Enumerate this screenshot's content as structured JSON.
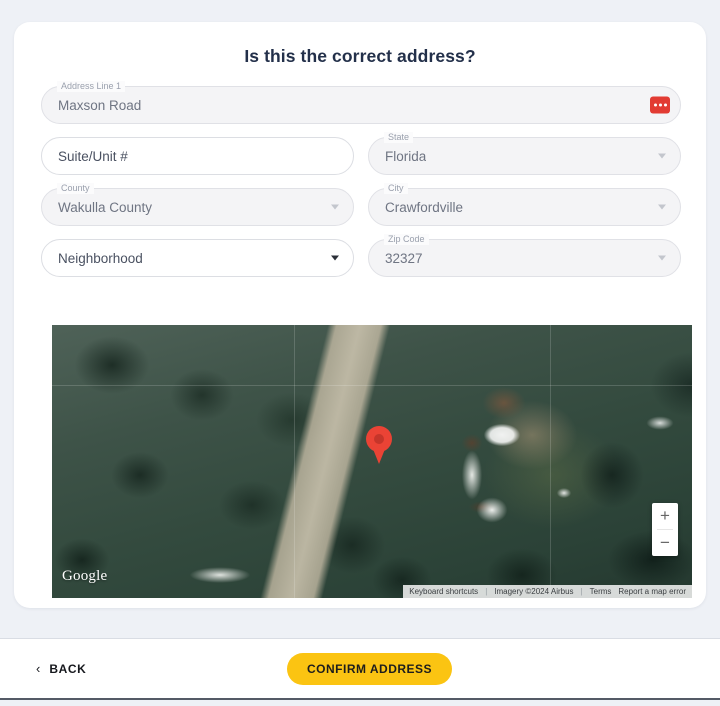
{
  "page": {
    "title": "Is this the correct address?"
  },
  "form": {
    "address_line_1": {
      "label": "Address Line 1",
      "value": "Maxson Road",
      "action_icon": "more-options-icon"
    },
    "suite_unit": {
      "label": "",
      "placeholder": "Suite/Unit #",
      "value": "Suite/Unit #"
    },
    "state": {
      "label": "State",
      "value": "Florida"
    },
    "county": {
      "label": "County",
      "value": "Wakulla County"
    },
    "city": {
      "label": "City",
      "value": "Crawfordville"
    },
    "neighborhood": {
      "label": "",
      "placeholder": "Neighborhood",
      "value": "Neighborhood"
    },
    "zip_code": {
      "label": "Zip Code",
      "value": "32327"
    }
  },
  "map": {
    "provider_logo": "Google",
    "zoom_in_label": "+",
    "zoom_out_label": "−",
    "marker": "location-pin",
    "attribution": {
      "keyboard_shortcuts": "Keyboard shortcuts",
      "imagery": "Imagery ©2024 Airbus",
      "terms": "Terms",
      "report": "Report a map error",
      "divider": "|"
    }
  },
  "footer": {
    "back_label": "BACK",
    "back_chevron": "‹",
    "confirm_label": "CONFIRM ADDRESS"
  },
  "colors": {
    "page_background": "#eef1f6",
    "card_background": "#ffffff",
    "title_text": "#23304a",
    "accent_button": "#fbc412",
    "action_icon": "#e23b33",
    "marker": "#ea4335",
    "field_filled_background": "#f4f4f6",
    "field_border": "#dcdee3"
  }
}
